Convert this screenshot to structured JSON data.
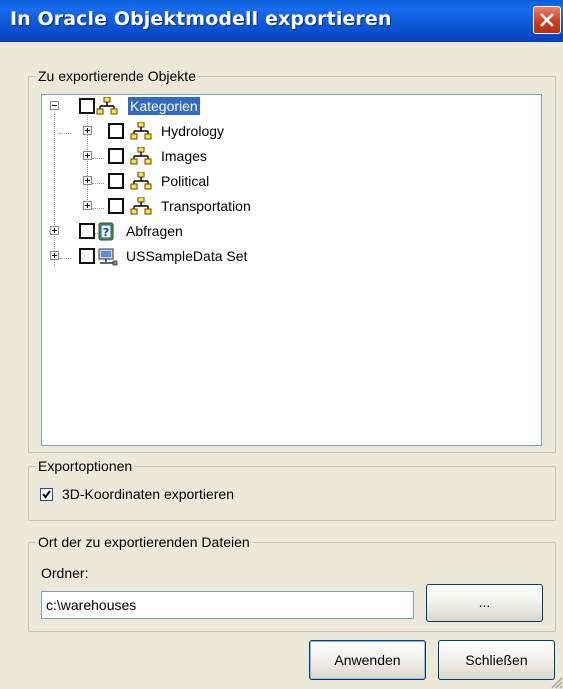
{
  "window": {
    "title": "In Oracle Objektmodell exportieren",
    "close_icon": "close-icon"
  },
  "objects_group": {
    "legend": "Zu exportierende Objekte",
    "tree": {
      "root": {
        "label": "Kategorien",
        "expanded": true,
        "checked": false,
        "selected": true,
        "icon": "category-icon"
      },
      "children": [
        {
          "label": "Hydrology",
          "checked": false,
          "icon": "category-icon"
        },
        {
          "label": "Images",
          "checked": false,
          "icon": "category-icon"
        },
        {
          "label": "Political",
          "checked": false,
          "icon": "category-icon"
        },
        {
          "label": "Transportation",
          "checked": false,
          "icon": "category-icon"
        }
      ],
      "others": [
        {
          "label": "Abfragen",
          "checked": false,
          "icon": "query-icon"
        },
        {
          "label": "USSampleData Set",
          "checked": false,
          "icon": "dataset-icon"
        }
      ]
    }
  },
  "export_options": {
    "legend": "Exportoptionen",
    "export_3d": {
      "label": "3D-Koordinaten exportieren",
      "checked": true
    }
  },
  "location": {
    "legend": "Ort der zu exportierenden Dateien",
    "folder_label": "Ordner:",
    "folder_value": "c:\\warehouses",
    "browse_label": "..."
  },
  "buttons": {
    "apply": "Anwenden",
    "close": "Schließen"
  }
}
